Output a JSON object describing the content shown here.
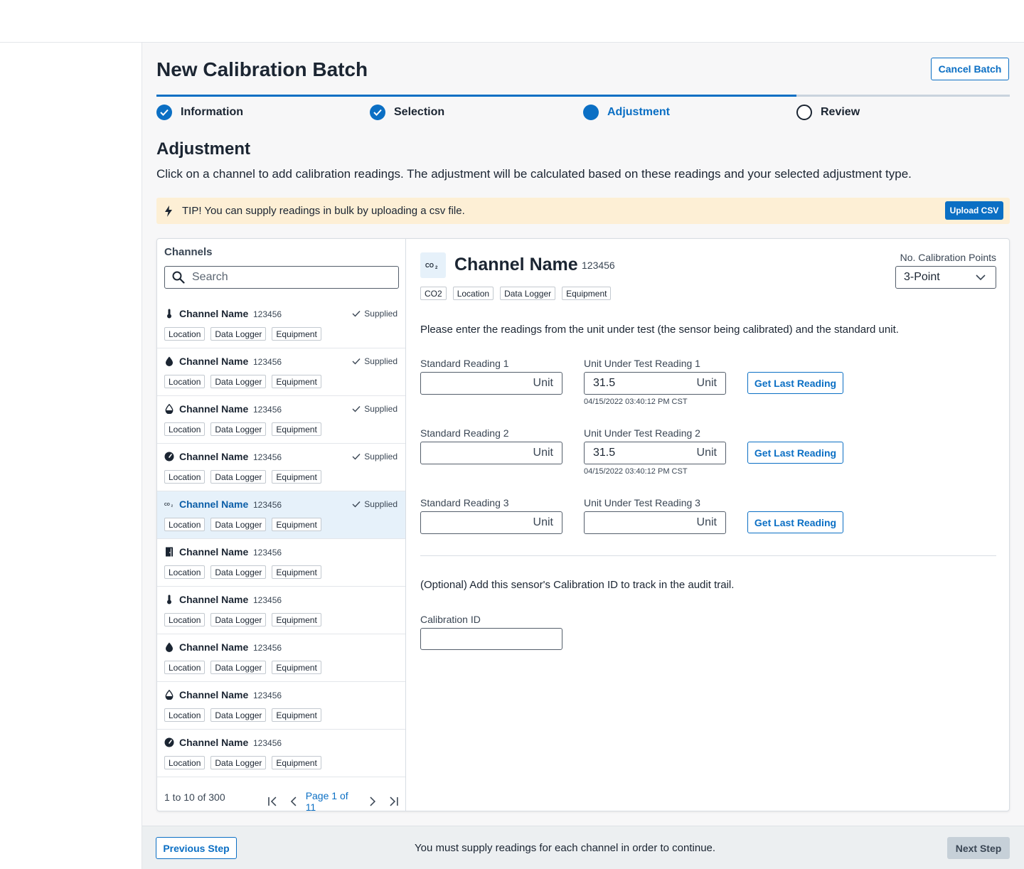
{
  "page": {
    "title": "New Calibration Batch",
    "cancel_label": "Cancel Batch"
  },
  "stepper": {
    "steps": [
      {
        "label": "Information",
        "state": "done"
      },
      {
        "label": "Selection",
        "state": "done"
      },
      {
        "label": "Adjustment",
        "state": "current"
      },
      {
        "label": "Review",
        "state": "todo"
      }
    ],
    "progress_fraction": 0.75
  },
  "section": {
    "title": "Adjustment",
    "description": "Click on a channel to add calibration readings. The adjustment will be calculated based on these readings and your selected adjustment type."
  },
  "tip": {
    "text": "TIP! You can supply readings in bulk by uploading a csv file.",
    "upload_label": "Upload CSV",
    "icon": "bolt-icon"
  },
  "channels": {
    "title": "Channels",
    "search_placeholder": "Search",
    "items": [
      {
        "icon": "thermometer-icon",
        "name": "Channel Name",
        "id": "123456",
        "status": "Supplied",
        "tags": [
          "Location",
          "Data Logger",
          "Equipment"
        ],
        "selected": false
      },
      {
        "icon": "droplet-icon",
        "name": "Channel Name",
        "id": "123456",
        "status": "Supplied",
        "tags": [
          "Location",
          "Data Logger",
          "Equipment"
        ],
        "selected": false
      },
      {
        "icon": "humidity-icon",
        "name": "Channel Name",
        "id": "123456",
        "status": "Supplied",
        "tags": [
          "Location",
          "Data Logger",
          "Equipment"
        ],
        "selected": false
      },
      {
        "icon": "gauge-icon",
        "name": "Channel Name",
        "id": "123456",
        "status": "Supplied",
        "tags": [
          "Location",
          "Data Logger",
          "Equipment"
        ],
        "selected": false
      },
      {
        "icon": "co2-icon",
        "name": "Channel Name",
        "id": "123456",
        "status": "Supplied",
        "tags": [
          "Location",
          "Data Logger",
          "Equipment"
        ],
        "selected": true
      },
      {
        "icon": "door-icon",
        "name": "Channel Name",
        "id": "123456",
        "status": "",
        "tags": [
          "Location",
          "Data Logger",
          "Equipment"
        ],
        "selected": false
      },
      {
        "icon": "thermometer-icon",
        "name": "Channel Name",
        "id": "123456",
        "status": "",
        "tags": [
          "Location",
          "Data Logger",
          "Equipment"
        ],
        "selected": false
      },
      {
        "icon": "droplet-icon",
        "name": "Channel Name",
        "id": "123456",
        "status": "",
        "tags": [
          "Location",
          "Data Logger",
          "Equipment"
        ],
        "selected": false
      },
      {
        "icon": "humidity-icon",
        "name": "Channel Name",
        "id": "123456",
        "status": "",
        "tags": [
          "Location",
          "Data Logger",
          "Equipment"
        ],
        "selected": false
      },
      {
        "icon": "gauge-icon",
        "name": "Channel Name",
        "id": "123456",
        "status": "",
        "tags": [
          "Location",
          "Data Logger",
          "Equipment"
        ],
        "selected": false
      }
    ],
    "pager": {
      "count": "1 to 10 of 300",
      "page_label": "Page 1 of 11"
    }
  },
  "detail": {
    "icon": "co2-icon",
    "name": "Channel Name",
    "id": "123456",
    "tags": [
      "CO2",
      "Location",
      "Data Logger",
      "Equipment"
    ],
    "points_label": "No. Calibration Points",
    "points_value": "3-Point",
    "instructions": "Please enter the readings from the unit under test (the sensor being calibrated) and the standard unit.",
    "readings": [
      {
        "std_label": "Standard Reading 1",
        "std_value": "",
        "std_unit": "Unit",
        "uut_label": "Unit Under Test Reading 1",
        "uut_value": "31.5",
        "uut_unit": "Unit",
        "timestamp": "04/15/2022 03:40:12 PM CST",
        "button": "Get Last Reading"
      },
      {
        "std_label": "Standard Reading 2",
        "std_value": "",
        "std_unit": "Unit",
        "uut_label": "Unit Under Test Reading 2",
        "uut_value": "31.5",
        "uut_unit": "Unit",
        "timestamp": "04/15/2022 03:40:12 PM CST",
        "button": "Get Last Reading"
      },
      {
        "std_label": "Standard Reading 3",
        "std_value": "",
        "std_unit": "Unit",
        "uut_label": "Unit Under Test Reading 3",
        "uut_value": "",
        "uut_unit": "Unit",
        "timestamp": "",
        "button": "Get Last Reading"
      }
    ],
    "optional_text": "(Optional) Add this sensor's Calibration ID to track in the audit trail.",
    "calibration_id_label": "Calibration ID",
    "calibration_id_value": ""
  },
  "footer": {
    "prev_label": "Previous Step",
    "message": "You must supply readings for each channel in order to continue.",
    "next_label": "Next Step"
  },
  "colors": {
    "primary": "#0b6fc4",
    "tip_bg": "#fdefd5",
    "selected_bg": "#e6f1fa",
    "disabled_btn": "#c6d0d8"
  }
}
